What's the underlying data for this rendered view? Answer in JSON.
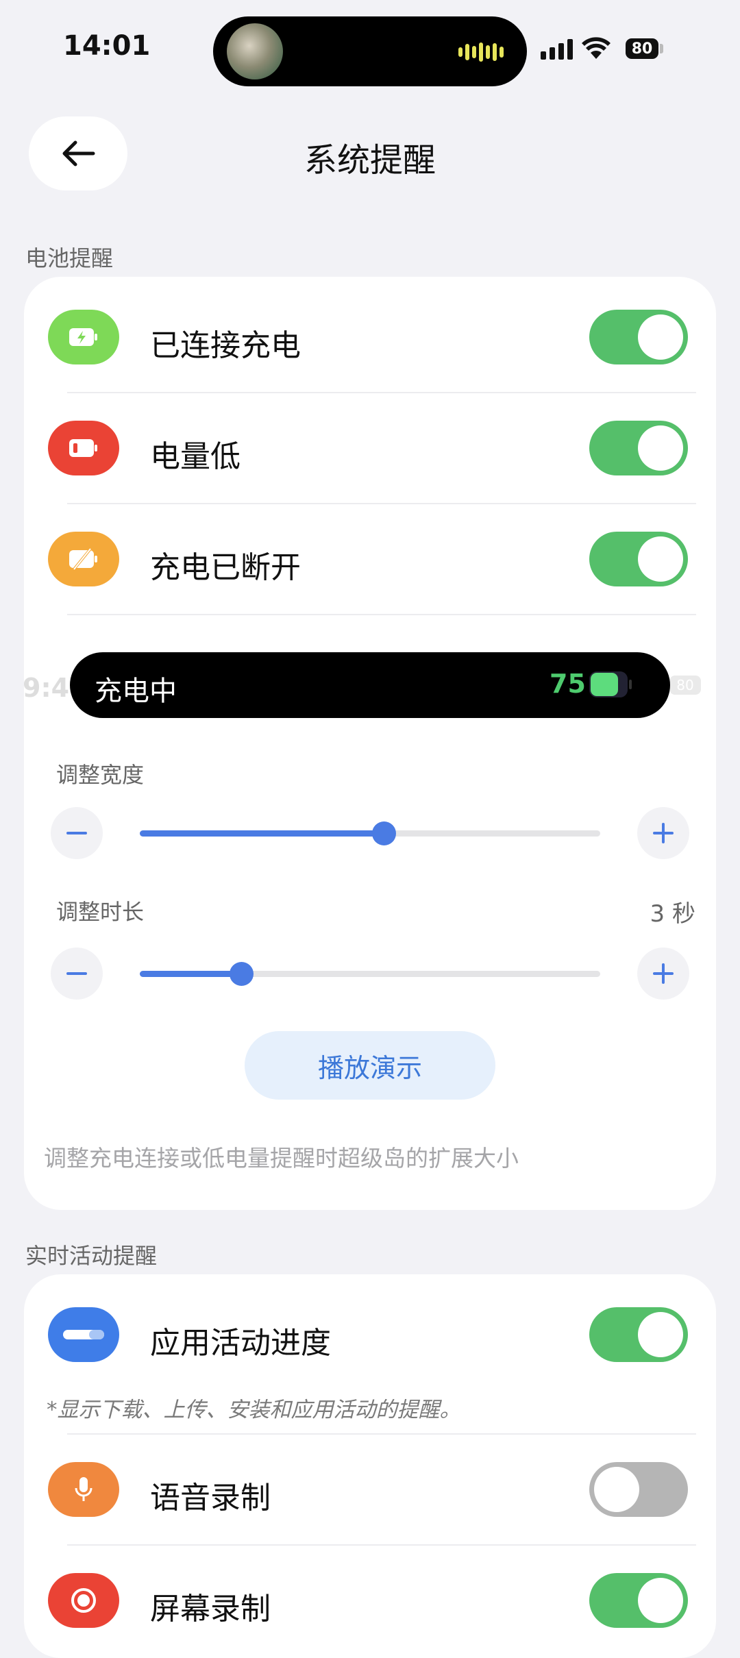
{
  "status_bar": {
    "time": "14:01",
    "battery_level": "80",
    "icons": [
      "media-avatar-icon",
      "audio-wave-icon",
      "signal-icon",
      "wifi-icon",
      "battery-icon"
    ]
  },
  "header": {
    "title": "系统提醒",
    "back_icon": "arrow-left-icon"
  },
  "battery_section": {
    "label": "电池提醒",
    "items": [
      {
        "label": "已连接充电",
        "icon": "battery-charging-icon",
        "icon_color": "#7ed957",
        "enabled": true
      },
      {
        "label": "电量低",
        "icon": "battery-low-icon",
        "icon_color": "#ea4335",
        "enabled": true
      },
      {
        "label": "充电已断开",
        "icon": "battery-disconnected-icon",
        "icon_color": "#f4a93a",
        "enabled": true
      }
    ],
    "preview": {
      "ghost_time_fragment": "9:4",
      "ghost_battery": "80",
      "text": "充电中",
      "battery_value": "75",
      "battery_color": "#5ddc7d"
    },
    "width_slider": {
      "label": "调整宽度",
      "fraction": 0.53
    },
    "duration_slider": {
      "label": "调整时长",
      "value": "3 秒",
      "fraction": 0.22
    },
    "demo_button": "播放演示",
    "hint": "调整充电连接或低电量提醒时超级岛的扩展大小"
  },
  "live_section": {
    "label": "实时活动提醒",
    "items": [
      {
        "label": "应用活动进度",
        "icon": "progress-bar-icon",
        "icon_color": "#3f7de8",
        "enabled": true
      },
      {
        "label": "语音录制",
        "icon": "microphone-icon",
        "icon_color": "#f0883e",
        "enabled": false
      },
      {
        "label": "屏幕录制",
        "icon": "record-icon",
        "icon_color": "#ea4335",
        "enabled": true
      }
    ],
    "note": "*显示下载、上传、安装和应用活动的提醒。"
  },
  "colors": {
    "toggle_on": "#55bf6a",
    "toggle_off": "#b5b5b5",
    "accent": "#4a7be3",
    "background": "#f2f2f6"
  }
}
